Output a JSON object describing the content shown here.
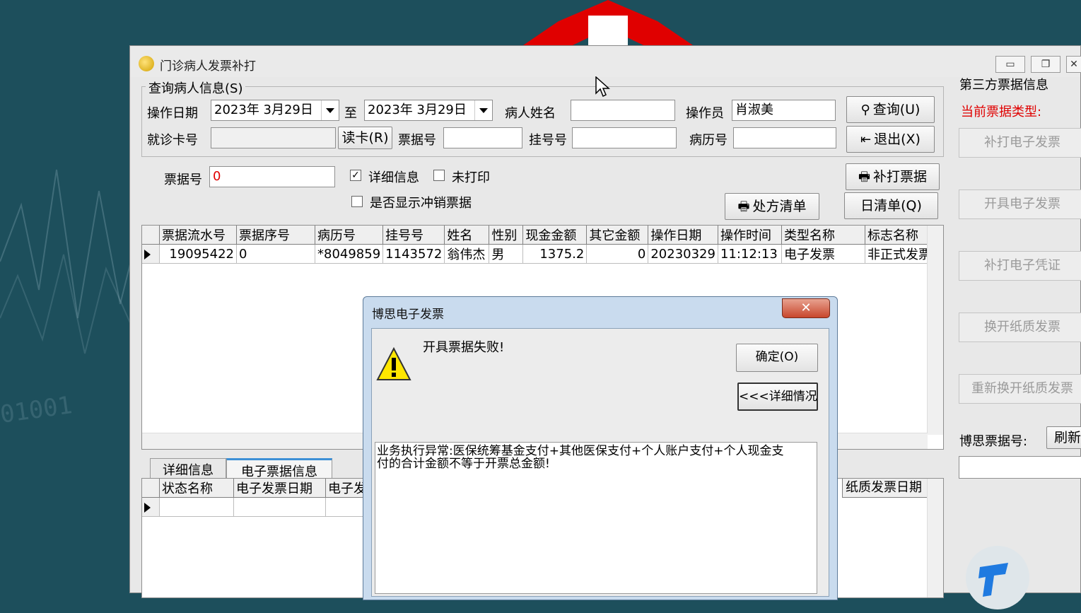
{
  "window": {
    "title": "门诊病人发票补打",
    "controls": [
      "▭",
      "❐",
      "✕"
    ]
  },
  "query_group": {
    "title": "查询病人信息(S)",
    "op_date_label": "操作日期",
    "date_from": "2023年 3月29日",
    "to_label": "至",
    "date_to": "2023年 3月29日",
    "patient_name_label": "病人姓名",
    "patient_name": "",
    "operator_label": "操作员",
    "operator": "肖淑美",
    "query_button": "查询(U)",
    "card_label": "就诊卡号",
    "card_no": "",
    "read_card_button": "读卡(R)",
    "receipt_label": "票据号",
    "receipt_value": "",
    "reg_label": "挂号号",
    "reg_value": "",
    "record_label": "病历号",
    "record_value": "",
    "exit_button": "退出(X)"
  },
  "options": {
    "receipt_label": "票据号",
    "receipt_value": "0",
    "detail_label": "详细信息",
    "detail_checked": true,
    "unprinted_label": "未打印",
    "unprinted_checked": false,
    "show_reversal_label": "是否显示冲销票据",
    "show_reversal_checked": false,
    "reprint_button": "补打票据",
    "prescription_button": "处方清单",
    "daily_button": "日清单(Q)"
  },
  "main_grid": {
    "columns": [
      "票据流水号",
      "票据序号",
      "病历号",
      "挂号号",
      "姓名",
      "性别",
      "现金金额",
      "其它金额",
      "操作日期",
      "操作时间",
      "类型名称",
      "标志名称"
    ],
    "rows": [
      [
        "19095422",
        "0",
        "*8049859",
        "1143572",
        "翁伟杰",
        "男",
        "1375.2",
        "0",
        "20230329",
        "11:12:13",
        "电子发票",
        "非正式发票"
      ]
    ]
  },
  "tabs": [
    "详细信息",
    "电子票据信息"
  ],
  "detail_grid": {
    "columns": [
      "状态名称",
      "电子发票日期",
      "电子发"
    ],
    "right_column": "纸质发票日期"
  },
  "right_panel": {
    "title": "第三方票据信息",
    "current_type_label": "当前票据类型:",
    "buttons": [
      "补打电子发票",
      "开具电子发票",
      "补打电子凭证",
      "换开纸质发票",
      "重新换开纸质发票"
    ],
    "bosi_label": "博思票据号:",
    "refresh_button": "刷新",
    "bosi_value": ""
  },
  "dialog": {
    "title": "博思电子发票",
    "close": "✕",
    "message": "开具票据失败!",
    "ok_button": "确定(O)",
    "details_button": "<<<详细情况",
    "detail_text": "业务执行异常:医保统筹基金支付+其他医保支付+个人账户支付+个人现金支付的合计金额不等于开票总金额!"
  },
  "colors": {
    "desktop": "#1d4f5c",
    "accent_red": "#e00000",
    "tab_accent": "#3c8fd6"
  }
}
